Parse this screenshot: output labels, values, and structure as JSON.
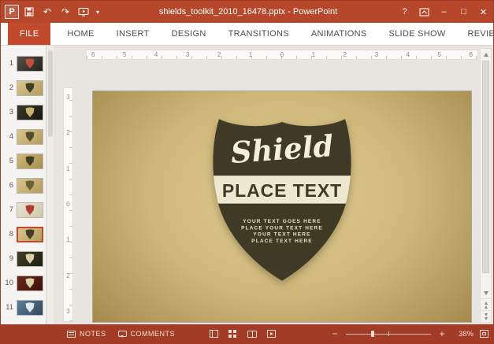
{
  "titlebar": {
    "title": "shields_toolkit_2010_16478.pptx - PowerPoint",
    "app_initial": "P",
    "icons": {
      "undo": "↶",
      "redo": "↷",
      "qat_dropdown": "▾",
      "help": "?",
      "minimize": "–",
      "maximize": "□",
      "close": "✕"
    }
  },
  "ribbon": {
    "file_tab": "FILE",
    "tabs": [
      "HOME",
      "INSERT",
      "DESIGN",
      "TRANSITIONS",
      "ANIMATIONS",
      "SLIDE SHOW",
      "REVIEW"
    ]
  },
  "slides_panel": {
    "slides": [
      {
        "number": "1",
        "bg1": "#55514a",
        "bg2": "#26231e",
        "shield": "#c0503a"
      },
      {
        "number": "2",
        "bg1": "#d9c58e",
        "bg2": "#b59c5e",
        "shield": "#413d27"
      },
      {
        "number": "3",
        "bg1": "#3a382f",
        "bg2": "#16150f",
        "shield": "#c9b469"
      },
      {
        "number": "4",
        "bg1": "#d9c58e",
        "bg2": "#b59c5e",
        "shield": "#554e2e"
      },
      {
        "number": "5",
        "bg1": "#cdb677",
        "bg2": "#a8904f",
        "shield": "#413d27"
      },
      {
        "number": "6",
        "bg1": "#d9c58e",
        "bg2": "#b59c5e",
        "shield": "#6b6236"
      },
      {
        "number": "7",
        "bg1": "#e9e3d2",
        "bg2": "#cfc6ac",
        "shield": "#b03c30"
      },
      {
        "number": "8",
        "bg1": "#d9c58e",
        "bg2": "#b59c5e",
        "shield": "#413d27",
        "selected": true
      },
      {
        "number": "9",
        "bg1": "#413d28",
        "bg2": "#201d12",
        "shield": "#d9cfa8"
      },
      {
        "number": "10",
        "bg1": "#6b251a",
        "bg2": "#3d120b",
        "shield": "#d9cfa8"
      },
      {
        "number": "11",
        "bg1": "#5c7d99",
        "bg2": "#32495e",
        "shield": "#dfe7ec"
      }
    ]
  },
  "rulers": {
    "horizontal": [
      "6",
      "5",
      "4",
      "3",
      "2",
      "1",
      "0",
      "1",
      "2",
      "3",
      "4",
      "5",
      "6"
    ],
    "vertical": [
      "3",
      "2",
      "1",
      "0",
      "1",
      "2",
      "3"
    ]
  },
  "slide": {
    "script_title": "Shield",
    "band_text": "PLACE TEXT",
    "body_lines": [
      "YOUR TEXT GOES HERE",
      "PLACE YOUR TEXT HERE",
      "YOUR TEXT HERE",
      "PLACE TEXT HERE"
    ]
  },
  "statusbar": {
    "notes_label": "NOTES",
    "comments_label": "COMMENTS",
    "zoom_out": "−",
    "zoom_in": "+",
    "zoom_level": "38%"
  },
  "colors": {
    "titlebar_red": "#B7472A",
    "file_tab_red": "#C24A2C",
    "statusbar_red": "#A33C26",
    "selection_red": "#C4492B",
    "slide_gold_light": "#E0CC97",
    "slide_gold_mid": "#CEB778",
    "slide_gold_dark": "#A3884C",
    "shield_dark": "#3E3A25",
    "band_cream": "#EFE8D1"
  }
}
